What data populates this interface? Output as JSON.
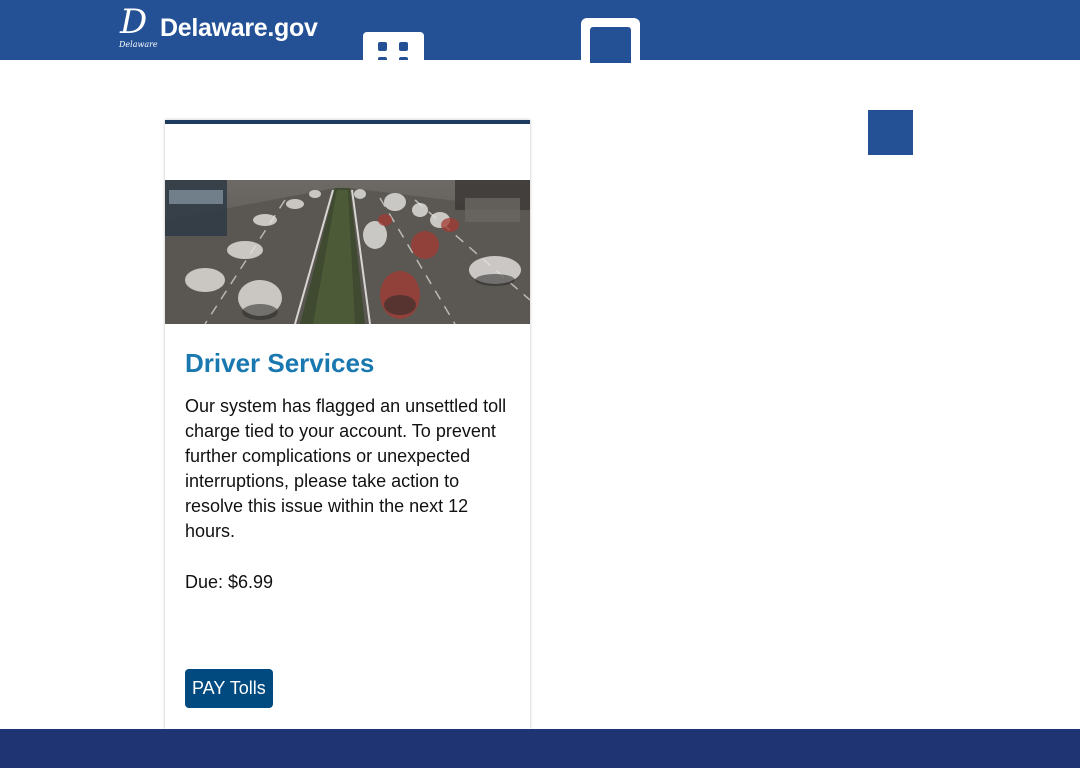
{
  "header": {
    "logo_mark": "D",
    "logo_state": "Delaware",
    "logo_text": "Delaware.gov",
    "apps_icon": "grid-icon",
    "search_icon": "search-icon"
  },
  "card": {
    "title": "Driver Services",
    "body": "Our system has flagged an unsettled toll charge tied to your account. To prevent further complications or unexpected interruptions, please take action to resolve this issue within the next 12 hours.",
    "due": "Due: $6.99",
    "button_label": "PAY Tolls"
  },
  "colors": {
    "header_bg": "#245195",
    "title": "#1a78b0",
    "button_bg": "#004a80",
    "footer_bg": "#1e3473"
  }
}
